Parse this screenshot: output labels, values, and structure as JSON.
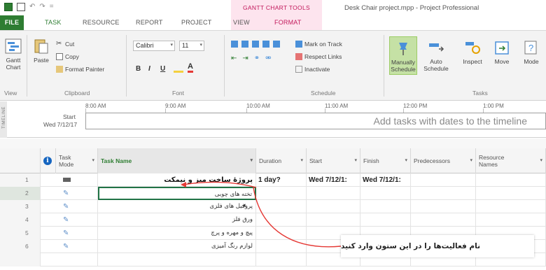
{
  "titlebar": {
    "quick_access": [
      "save-icon",
      "undo-icon",
      "redo-icon"
    ],
    "undo_glyph": "↶",
    "redo_glyph": "↷",
    "more_glyph": "=",
    "contextual_group": "GANTT CHART TOOLS",
    "window_title": "Desk Chair project.mpp - Project Professional"
  },
  "tabs": [
    "FILE",
    "TASK",
    "RESOURCE",
    "REPORT",
    "PROJECT",
    "VIEW",
    "FORMAT"
  ],
  "ribbon": {
    "view_group": {
      "button": "Gantt Chart",
      "label": "View"
    },
    "clipboard": {
      "paste": "Paste",
      "cut": "Cut",
      "copy": "Copy",
      "format_painter": "Format Painter",
      "label": "Clipboard"
    },
    "font": {
      "family": "Calibri",
      "size": "11",
      "bold": "B",
      "italic": "I",
      "underline": "U",
      "label": "Font"
    },
    "schedule": {
      "mark_on_track": "Mark on Track",
      "respect_links": "Respect Links",
      "inactivate": "Inactivate",
      "label": "Schedule"
    },
    "tasks": {
      "manually": "Manually Schedule",
      "auto": "Auto Schedule",
      "inspect": "Inspect",
      "move": "Move",
      "mode": "Mode",
      "label": "Tasks"
    }
  },
  "timeline": {
    "side_label": "TIMELINE",
    "ticks": [
      "8:00 AM",
      "9:00 AM",
      "10:00 AM",
      "11:00 AM",
      "12:00 PM",
      "1:00 PM"
    ],
    "start_label": "Start",
    "start_date": "Wed 7/12/17",
    "placeholder": "Add tasks with dates to the timeline"
  },
  "table": {
    "headers": {
      "info": "i",
      "mode": "Task Mode",
      "name": "Task Name",
      "duration": "Duration",
      "start": "Start",
      "finish": "Finish",
      "predecessors": "Predecessors",
      "resources": "Resource Names"
    },
    "rows": [
      {
        "num": "1",
        "name": "پروژهٔ ساخت میز و نیمکت",
        "mark": "◂",
        "duration": "1 day?",
        "start": "Wed 7/12/1:",
        "finish": "Wed 7/12/1:"
      },
      {
        "num": "2",
        "name": "تخته های چوبی",
        "mark": "",
        "duration": "",
        "start": "",
        "finish": ""
      },
      {
        "num": "3",
        "name": "پروفیل های فلزی",
        "mark": "",
        "duration": "",
        "start": "",
        "finish": ""
      },
      {
        "num": "4",
        "name": "ورق فلز",
        "mark": "",
        "duration": "",
        "start": "",
        "finish": ""
      },
      {
        "num": "5",
        "name": "پیچ و مهره و پرچ",
        "mark": "",
        "duration": "",
        "start": "",
        "finish": ""
      },
      {
        "num": "6",
        "name": "لوازم رنگ آمیزی",
        "mark": "",
        "duration": "",
        "start": "",
        "finish": ""
      }
    ],
    "pin_glyph": "✎"
  },
  "callout": {
    "text": "نام فعالیت‌ها را در این ستون وارد کنید"
  },
  "colors": {
    "accent_green": "#2e7d32",
    "format_pink": "#c2185b",
    "arrow_red": "#e53935"
  }
}
